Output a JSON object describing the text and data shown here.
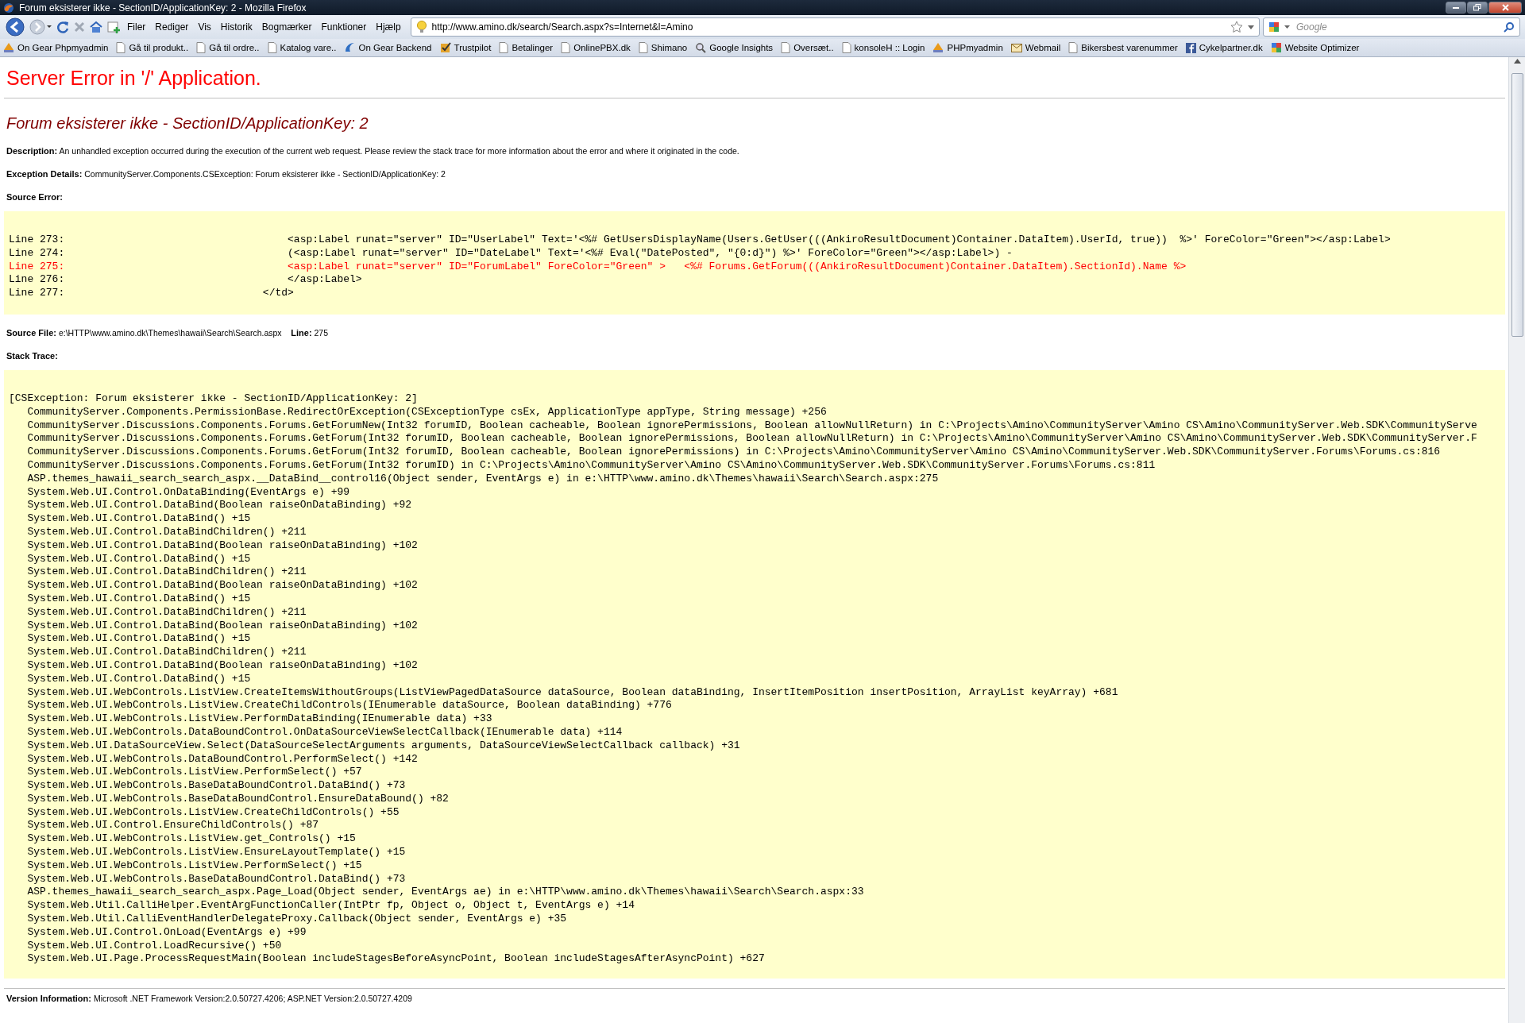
{
  "window": {
    "title": "Forum eksisterer ikke - SectionID/ApplicationKey: 2 - Mozilla Firefox"
  },
  "menu": [
    "Filer",
    "Rediger",
    "Vis",
    "Historik",
    "Bogmærker",
    "Funktioner",
    "Hjælp"
  ],
  "address": {
    "value": "http://www.amino.dk/search/Search.aspx?s=Internet&l=Amino"
  },
  "search": {
    "placeholder": "Google"
  },
  "bookmarks": [
    {
      "label": "On Gear Phpmyadmin",
      "kind": "pma"
    },
    {
      "label": "Gå til produkt..",
      "kind": "page"
    },
    {
      "label": "Gå til ordre..",
      "kind": "page"
    },
    {
      "label": "Katalog vare..",
      "kind": "page"
    },
    {
      "label": "On Gear Backend",
      "kind": "wave"
    },
    {
      "label": "Trustpilot",
      "kind": "check"
    },
    {
      "label": "Betalinger",
      "kind": "page"
    },
    {
      "label": "OnlinePBX.dk",
      "kind": "page"
    },
    {
      "label": "Shimano",
      "kind": "page"
    },
    {
      "label": "Google Insights",
      "kind": "magnifier"
    },
    {
      "label": "Oversæt..",
      "kind": "page"
    },
    {
      "label": "konsoleH :: Login",
      "kind": "page"
    },
    {
      "label": "PHPmyadmin",
      "kind": "pma"
    },
    {
      "label": "Webmail",
      "kind": "mail"
    },
    {
      "label": "Bikersbest varenummer",
      "kind": "page"
    },
    {
      "label": "Cykelpartner.dk",
      "kind": "facebook"
    },
    {
      "label": "Website Optimizer",
      "kind": "google"
    }
  ],
  "page": {
    "heading": "Server Error in '/' Application.",
    "subheading": "Forum eksisterer ikke - SectionID/ApplicationKey: 2",
    "description": {
      "label": "Description:",
      "text": "An unhandled exception occurred during the execution of the current web request. Please review the stack trace for more information about the error and where it originated in the code."
    },
    "exception_details": {
      "label": "Exception Details:",
      "text": "CommunityServer.Components.CSException: Forum eksisterer ikke - SectionID/ApplicationKey: 2"
    },
    "source_error_label": "Source Error:",
    "source_lines": [
      {
        "text": "Line 273:                                    <asp:Label runat=\"server\" ID=\"UserLabel\" Text='<%# GetUsersDisplayName(Users.GetUser(((AnkiroResultDocument)Container.DataItem).UserId, true))  %>' ForeColor=\"Green\"></asp:Label>",
        "error": false
      },
      {
        "text": "Line 274:                                    (<asp:Label runat=\"server\" ID=\"DateLabel\" Text='<%# Eval(\"DatePosted\", \"{0:d}\") %>' ForeColor=\"Green\"></asp:Label>) -",
        "error": false
      },
      {
        "text": "Line 275:                                    <asp:Label runat=\"server\" ID=\"ForumLabel\" ForeColor=\"Green\" >   <%# Forums.GetForum(((AnkiroResultDocument)Container.DataItem).SectionId).Name %>",
        "error": true
      },
      {
        "text": "Line 276:                                    </asp:Label>",
        "error": false
      },
      {
        "text": "Line 277:                                </td>",
        "error": false
      }
    ],
    "source_file": {
      "label": "Source File:",
      "value": "e:\\HTTP\\www.amino.dk\\Themes\\hawaii\\Search\\Search.aspx",
      "line_label": "Line:",
      "line_value": "275"
    },
    "stack_trace_label": "Stack Trace:",
    "stack_lines": [
      "[CSException: Forum eksisterer ikke - SectionID/ApplicationKey: 2]",
      "   CommunityServer.Components.PermissionBase.RedirectOrException(CSExceptionType csEx, ApplicationType appType, String message) +256",
      "   CommunityServer.Discussions.Components.Forums.GetForumNew(Int32 forumID, Boolean cacheable, Boolean ignorePermissions, Boolean allowNullReturn) in C:\\Projects\\Amino\\CommunityServer\\Amino CS\\Amino\\CommunityServer.Web.SDK\\CommunityServe",
      "   CommunityServer.Discussions.Components.Forums.GetForum(Int32 forumID, Boolean cacheable, Boolean ignorePermissions, Boolean allowNullReturn) in C:\\Projects\\Amino\\CommunityServer\\Amino CS\\Amino\\CommunityServer.Web.SDK\\CommunityServer.F",
      "   CommunityServer.Discussions.Components.Forums.GetForum(Int32 forumID, Boolean cacheable, Boolean ignorePermissions) in C:\\Projects\\Amino\\CommunityServer\\Amino CS\\Amino\\CommunityServer.Web.SDK\\CommunityServer.Forums\\Forums.cs:816",
      "   CommunityServer.Discussions.Components.Forums.GetForum(Int32 forumID) in C:\\Projects\\Amino\\CommunityServer\\Amino CS\\Amino\\CommunityServer.Web.SDK\\CommunityServer.Forums\\Forums.cs:811",
      "   ASP.themes_hawaii_search_search_aspx.__DataBind__control16(Object sender, EventArgs e) in e:\\HTTP\\www.amino.dk\\Themes\\hawaii\\Search\\Search.aspx:275",
      "   System.Web.UI.Control.OnDataBinding(EventArgs e) +99",
      "   System.Web.UI.Control.DataBind(Boolean raiseOnDataBinding) +92",
      "   System.Web.UI.Control.DataBind() +15",
      "   System.Web.UI.Control.DataBindChildren() +211",
      "   System.Web.UI.Control.DataBind(Boolean raiseOnDataBinding) +102",
      "   System.Web.UI.Control.DataBind() +15",
      "   System.Web.UI.Control.DataBindChildren() +211",
      "   System.Web.UI.Control.DataBind(Boolean raiseOnDataBinding) +102",
      "   System.Web.UI.Control.DataBind() +15",
      "   System.Web.UI.Control.DataBindChildren() +211",
      "   System.Web.UI.Control.DataBind(Boolean raiseOnDataBinding) +102",
      "   System.Web.UI.Control.DataBind() +15",
      "   System.Web.UI.Control.DataBindChildren() +211",
      "   System.Web.UI.Control.DataBind(Boolean raiseOnDataBinding) +102",
      "   System.Web.UI.Control.DataBind() +15",
      "   System.Web.UI.WebControls.ListView.CreateItemsWithoutGroups(ListViewPagedDataSource dataSource, Boolean dataBinding, InsertItemPosition insertPosition, ArrayList keyArray) +681",
      "   System.Web.UI.WebControls.ListView.CreateChildControls(IEnumerable dataSource, Boolean dataBinding) +776",
      "   System.Web.UI.WebControls.ListView.PerformDataBinding(IEnumerable data) +33",
      "   System.Web.UI.WebControls.DataBoundControl.OnDataSourceViewSelectCallback(IEnumerable data) +114",
      "   System.Web.UI.DataSourceView.Select(DataSourceSelectArguments arguments, DataSourceViewSelectCallback callback) +31",
      "   System.Web.UI.WebControls.DataBoundControl.PerformSelect() +142",
      "   System.Web.UI.WebControls.ListView.PerformSelect() +57",
      "   System.Web.UI.WebControls.BaseDataBoundControl.DataBind() +73",
      "   System.Web.UI.WebControls.BaseDataBoundControl.EnsureDataBound() +82",
      "   System.Web.UI.WebControls.ListView.CreateChildControls() +55",
      "   System.Web.UI.Control.EnsureChildControls() +87",
      "   System.Web.UI.WebControls.ListView.get_Controls() +15",
      "   System.Web.UI.WebControls.ListView.EnsureLayoutTemplate() +15",
      "   System.Web.UI.WebControls.ListView.PerformSelect() +15",
      "   System.Web.UI.WebControls.BaseDataBoundControl.DataBind() +73",
      "   ASP.themes_hawaii_search_search_aspx.Page_Load(Object sender, EventArgs ae) in e:\\HTTP\\www.amino.dk\\Themes\\hawaii\\Search\\Search.aspx:33",
      "   System.Web.Util.CalliHelper.EventArgFunctionCaller(IntPtr fp, Object o, Object t, EventArgs e) +14",
      "   System.Web.Util.CalliEventHandlerDelegateProxy.Callback(Object sender, EventArgs e) +35",
      "   System.Web.UI.Control.OnLoad(EventArgs e) +99",
      "   System.Web.UI.Control.LoadRecursive() +50",
      "   System.Web.UI.Page.ProcessRequestMain(Boolean includeStagesBeforeAsyncPoint, Boolean includeStagesAfterAsyncPoint) +627"
    ],
    "version": {
      "label": "Version Information:",
      "text": "Microsoft .NET Framework Version:2.0.50727.4206; ASP.NET Version:2.0.50727.4209"
    }
  }
}
